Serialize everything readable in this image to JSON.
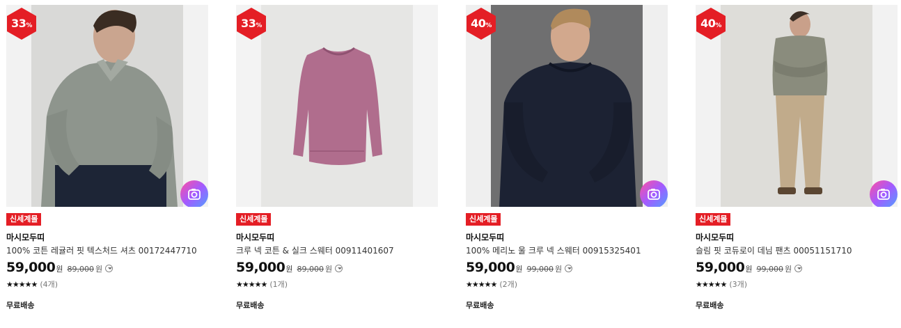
{
  "products": [
    {
      "discount": "33",
      "percent_sign": "%",
      "tag": "신세계몰",
      "brand": "마시모두띠",
      "name": "100% 코튼 레귤러 핏 텍스처드 셔츠 00172447710",
      "price": "59,000",
      "currency": "원",
      "original_price": "89,000",
      "stars": "★★★★★",
      "reviews": "(4개)",
      "shipping": "무료배송",
      "image": "model-in-grey-shirt",
      "lens_icon": "camera-search-icon"
    },
    {
      "discount": "33",
      "percent_sign": "%",
      "tag": "신세계몰",
      "brand": "마시모두띠",
      "name": "크루 넥 코튼 & 실크 스웨터 00911401607",
      "price": "59,000",
      "currency": "원",
      "original_price": "89,000",
      "stars": "★★★★★",
      "reviews": "(1개)",
      "shipping": "무료배송",
      "image": "pink-crew-neck-sweater",
      "lens_icon": "camera-search-icon"
    },
    {
      "discount": "40",
      "percent_sign": "%",
      "tag": "신세계몰",
      "brand": "마시모두띠",
      "name": "100% 메리노 울 크루 넥 스웨터 00915325401",
      "price": "59,000",
      "currency": "원",
      "original_price": "99,000",
      "stars": "★★★★★",
      "reviews": "(2개)",
      "shipping": "무료배송",
      "image": "model-in-navy-sweater",
      "lens_icon": "camera-search-icon"
    },
    {
      "discount": "40",
      "percent_sign": "%",
      "tag": "신세계몰",
      "brand": "마시모두띠",
      "name": "슬림 핏 코듀로이 데님 팬츠 00051151710",
      "price": "59,000",
      "currency": "원",
      "original_price": "99,000",
      "stars": "★★★★★",
      "reviews": "(3개)",
      "shipping": "무료배송",
      "image": "model-in-beige-corduroy-pants",
      "lens_icon": "camera-search-icon"
    }
  ],
  "colors": {
    "badge": "#e41e25",
    "tag": "#e41e25",
    "text": "#111111"
  }
}
